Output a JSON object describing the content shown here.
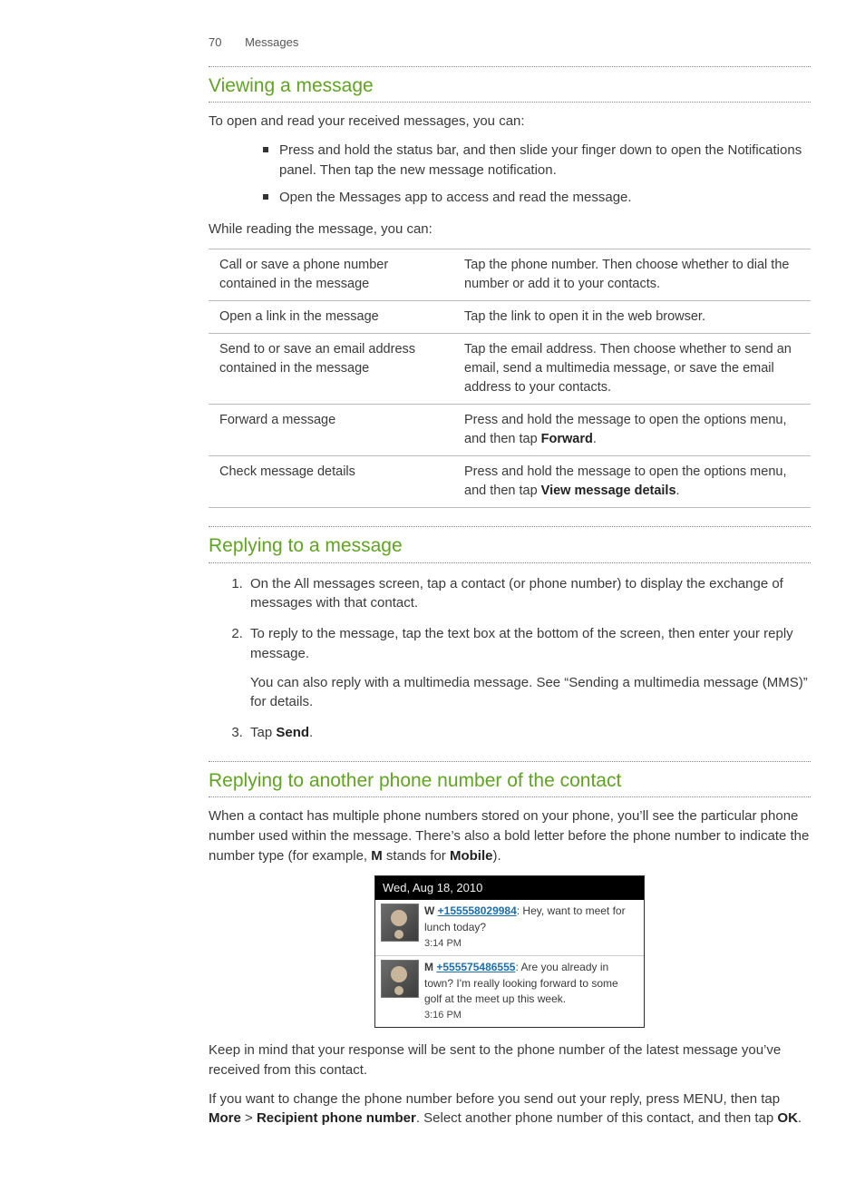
{
  "header": {
    "page_number": "70",
    "section": "Messages"
  },
  "s1": {
    "title": "Viewing a message",
    "intro": "To open and read your received messages, you can:",
    "bullets": [
      "Press and hold the status bar, and then slide your finger down to open the Notifications panel. Then tap the new message notification.",
      "Open the Messages app to access and read the message."
    ],
    "while_reading": "While reading the message, you can:",
    "table": [
      {
        "l": "Call or save a phone number contained in the message",
        "r": "Tap the phone number. Then choose whether to dial the number or add it to your contacts."
      },
      {
        "l": "Open a link in the message",
        "r": "Tap the link to open it in the web browser."
      },
      {
        "l": "Send to or save an email address contained in the message",
        "r": "Tap the email address. Then choose whether to send an email, send a multimedia message, or save the email address to your contacts."
      },
      {
        "l": "Forward a message",
        "r_pre": "Press and hold the message to open the options menu, and then tap ",
        "r_bold": "Forward",
        "r_post": "."
      },
      {
        "l": "Check message details",
        "r_pre": "Press and hold the message to open the options menu, and then tap ",
        "r_bold": "View message details",
        "r_post": "."
      }
    ]
  },
  "s2": {
    "title": "Replying to a message",
    "step1": "On the All messages screen, tap a contact (or phone number) to display the exchange of messages with that contact.",
    "step2": "To reply to the message, tap the text box at the bottom of the screen, then enter your reply message.",
    "step2_note": "You can also reply with a multimedia message. See “Sending a multimedia message (MMS)” for details.",
    "step3_pre": "Tap ",
    "step3_bold": "Send",
    "step3_post": "."
  },
  "s3": {
    "title": "Replying to another phone number of the contact",
    "intro_pre": "When a contact has multiple phone numbers stored on your phone, you’ll see the particular phone number used within the message. There’s also a bold letter before the phone number to indicate the number type (for example, ",
    "intro_b1": "M",
    "intro_mid": " stands for ",
    "intro_b2": "Mobile",
    "intro_post": ").",
    "phone": {
      "date": "Wed, Aug 18, 2010",
      "msgs": [
        {
          "prefix": "W",
          "num": "+155558029984",
          "text": ": Hey, want to meet for lunch today?",
          "time": "3:14 PM"
        },
        {
          "prefix": "M",
          "num": "+555575486555",
          "text": ": Are you already in town? I'm really looking forward to some golf at the meet up this week.",
          "time": "3:16 PM"
        }
      ]
    },
    "para2": "Keep in mind that your response will be sent to the phone number of the latest message you’ve received from this contact.",
    "para3_pre": "If you want to change the phone number before you send out your reply, press MENU, then tap ",
    "para3_b1": "More",
    "para3_mid1": " > ",
    "para3_b2": "Recipient phone number",
    "para3_mid2": ". Select another phone number of this contact, and then tap ",
    "para3_b3": "OK",
    "para3_post": "."
  }
}
